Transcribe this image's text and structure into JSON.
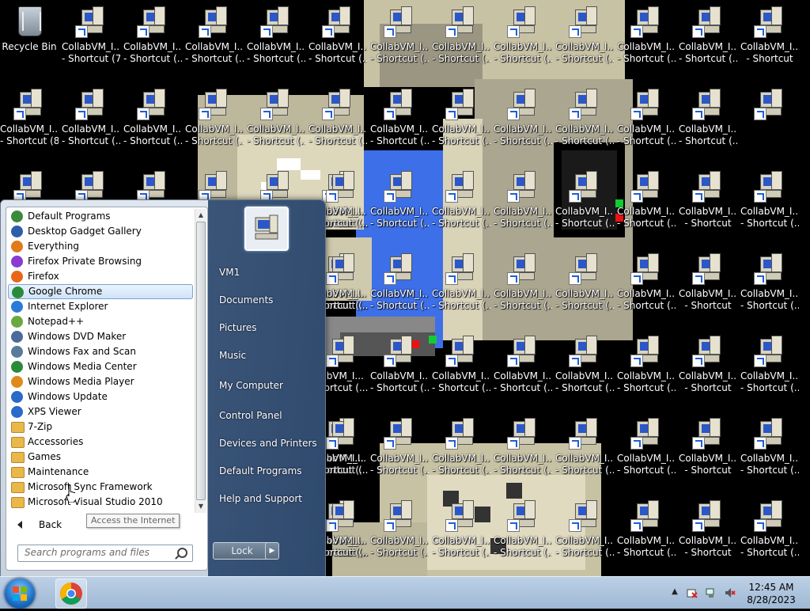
{
  "desktop": {
    "recycle_bin_label": "Recycle Bin",
    "icons": [
      {
        "line1": "CollabVM_I...",
        "line2": "- Shortcut (7)"
      },
      {
        "line1": "CollabVM_I...",
        "line2": "- Shortcut (..."
      },
      {
        "line1": "CollabVM_I...",
        "line2": "- Shortcut (..."
      },
      {
        "line1": "CollabVM_I...",
        "line2": "- Shortcut (..."
      },
      {
        "line1": "CollabVM_I...",
        "line2": "- Shortcut (..."
      },
      {
        "line1": "CollabVM_I...",
        "line2": "- Shortcut (..."
      },
      {
        "line1": "CollabVM_I...",
        "line2": "- Shortcut (..."
      },
      {
        "line1": "CollabVM_I...",
        "line2": "- Shortcut (..."
      },
      {
        "line1": "CollabVM_I...",
        "line2": "- Shortcut (..."
      },
      {
        "line1": "CollabVM_I...",
        "line2": "- Shortcut (..."
      },
      {
        "line1": "CollabVM_I...",
        "line2": "- Shortcut (..."
      },
      {
        "line1": "CollabVM_I...",
        "line2": "- Shortcut"
      },
      {
        "line1": "CollabVM_I...",
        "line2": "- Shortcut (8)"
      },
      {
        "line1": "CollabVM_I...",
        "line2": "- Shortcut (..."
      },
      {
        "line1": "CollabVM_I...",
        "line2": "- Shortcut (..."
      },
      {
        "line1": "CollabVM_I...",
        "line2": "- Shortcut (..."
      },
      {
        "line1": "CollabVM_I...",
        "line2": "- Shortcut (..."
      },
      {
        "line1": "CollabVM_I...",
        "line2": "- Shortcut (..."
      },
      {
        "line1": "CollabVM_I...",
        "line2": "- Shortcut (..."
      },
      {
        "line1": "CollabVM_I...",
        "line2": "- Shortcut (..."
      },
      {
        "line1": "CollabVM_I...",
        "line2": "- Shortcut (..."
      },
      {
        "line1": "CollabVM_I...",
        "line2": "- Shortcut (..."
      },
      {
        "line1": "CollabVM_I...",
        "line2": "- Shortcut (..."
      },
      {
        "line1": "CollabVM_I...",
        "line2": "- Shortcut (..."
      }
    ],
    "partial_label_line1": "labVM_I...",
    "partial_label_line2": "hortcut (..."
  },
  "start_menu": {
    "programs": [
      {
        "label": "Default Programs",
        "icon": "default-programs-icon",
        "color": "#3a8a3a"
      },
      {
        "label": "Desktop Gadget Gallery",
        "icon": "gadget-gallery-icon",
        "color": "#2d5fa8"
      },
      {
        "label": "Everything",
        "icon": "everything-icon",
        "color": "#e07a1a"
      },
      {
        "label": "Firefox Private Browsing",
        "icon": "firefox-private-icon",
        "color": "#8a3ad0"
      },
      {
        "label": "Firefox",
        "icon": "firefox-icon",
        "color": "#e8661a"
      },
      {
        "label": "Google Chrome",
        "icon": "chrome-icon",
        "color": "#2a8a3a"
      },
      {
        "label": "Internet Explorer",
        "icon": "internet-explorer-icon",
        "color": "#2a7ad8"
      },
      {
        "label": "Notepad++",
        "icon": "notepad-plus-plus-icon",
        "color": "#6aa840"
      },
      {
        "label": "Windows DVD Maker",
        "icon": "dvd-maker-icon",
        "color": "#4a6a9a"
      },
      {
        "label": "Windows Fax and Scan",
        "icon": "fax-scan-icon",
        "color": "#5a7a9a"
      },
      {
        "label": "Windows Media Center",
        "icon": "media-center-icon",
        "color": "#2a8a3a"
      },
      {
        "label": "Windows Media Player",
        "icon": "media-player-icon",
        "color": "#e08a1a"
      },
      {
        "label": "Windows Update",
        "icon": "windows-update-icon",
        "color": "#2a6ac8"
      },
      {
        "label": "XPS Viewer",
        "icon": "xps-viewer-icon",
        "color": "#2a6ac8"
      },
      {
        "label": "7-Zip",
        "icon": "folder-icon",
        "color": "folder"
      },
      {
        "label": "Accessories",
        "icon": "folder-icon",
        "color": "folder"
      },
      {
        "label": "Games",
        "icon": "folder-icon",
        "color": "folder"
      },
      {
        "label": "Maintenance",
        "icon": "folder-icon",
        "color": "folder"
      },
      {
        "label": "Microsoft Sync Framework",
        "icon": "folder-icon",
        "color": "folder"
      },
      {
        "label": "Microsoft Visual Studio 2010",
        "icon": "folder-icon",
        "color": "folder"
      }
    ],
    "selected_program": "Google Chrome",
    "tooltip": "Access the Internet",
    "back_label": "Back",
    "search_placeholder": "Search programs and files",
    "right_links": [
      "VM1",
      "Documents",
      "Pictures",
      "Music",
      "My Computer",
      "Control Panel",
      "Devices and Printers",
      "Default Programs",
      "Help and Support"
    ],
    "lock_label": "Lock"
  },
  "taskbar": {
    "time": "12:45 AM",
    "date": "8/28/2023"
  }
}
